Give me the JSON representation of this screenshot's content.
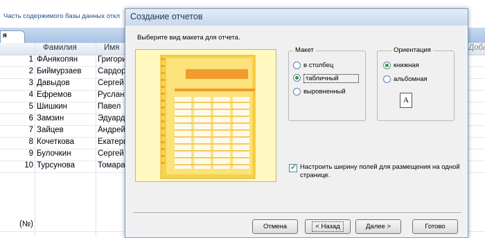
{
  "background": {
    "message": "Часть содержимого базы данных откл",
    "tab_label": "я",
    "columns": [
      "Фамилия",
      "Имя",
      "Доба"
    ],
    "rows": [
      {
        "num": "1",
        "last": "ФАнякопян",
        "first": "Григори"
      },
      {
        "num": "2",
        "last": "Биймурзаев",
        "first": "Сардор"
      },
      {
        "num": "3",
        "last": "Давыдов",
        "first": "Сергей"
      },
      {
        "num": "4",
        "last": "Ефремов",
        "first": "Руслан"
      },
      {
        "num": "5",
        "last": "Шишкин",
        "first": "Павел"
      },
      {
        "num": "6",
        "last": "Замзин",
        "first": "Эдуард"
      },
      {
        "num": "7",
        "last": "Зайцев",
        "first": "Андрей"
      },
      {
        "num": "8",
        "last": "Кочеткова",
        "first": "Екатери"
      },
      {
        "num": "9",
        "last": "Булочкин",
        "first": "Сергей"
      },
      {
        "num": "10",
        "last": "Турсунова",
        "first": "Томара"
      }
    ],
    "new_row": "(№)"
  },
  "dialog": {
    "title": "Создание отчетов",
    "prompt": "Выберите вид макета для отчета.",
    "layout_group": {
      "title": "Макет",
      "options": [
        {
          "label": "в столбец",
          "selected": false
        },
        {
          "label": "табличный",
          "selected": true
        },
        {
          "label": "выровненный",
          "selected": false
        }
      ]
    },
    "orientation_group": {
      "title": "Ориентация",
      "options": [
        {
          "label": "книжная",
          "selected": true
        },
        {
          "label": "альбомная",
          "selected": false
        }
      ],
      "icon_letter": "A"
    },
    "adjust_width": {
      "checked": true,
      "label": "Настроить ширину полей для размещения на одной странице."
    },
    "buttons": {
      "cancel": "Отмена",
      "back": "< Назад",
      "next": "Далее >",
      "finish": "Готово"
    }
  }
}
